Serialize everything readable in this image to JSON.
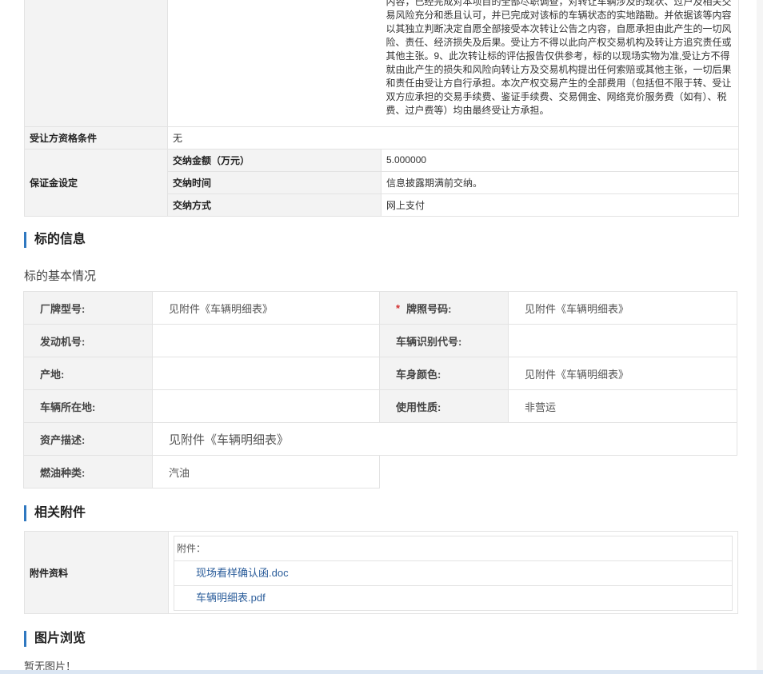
{
  "notes_text": "内容，已经完成对本项目的全部尽职调查，对转让车辆涉及的现状、过户及相关交易风险充分和悉且认可，并已完成对该标的车辆状态的实地踏勘。并依据该等内容以其独立判断决定自愿全部接受本次转让公告之内容，自愿承担由此产生的一切风险、责任、经济损失及后果。受让方不得以此向产权交易机构及转让方追究责任或其他主张。9、此次转让标的评估报告仅供参考，标的以现场实物为准,受让方不得就由此产生的损失和风险向转让方及交易机构提出任何索赔或其他主张，一切后果和责任由受让方自行承担。本次产权交易产生的全部费用（包括但不限于转、受让双方应承担的交易手续费、鉴证手续费、交易佣金、网络竞价服务费（如有）、税费、过户费等）均由最终受让方承担。",
  "qualification": {
    "label": "受让方资格条件",
    "value": "无"
  },
  "deposit": {
    "label": "保证金设定",
    "rows": [
      {
        "label": "交纳金额（万元）",
        "value": "5.000000"
      },
      {
        "label": "交纳时间",
        "value": "信息披露期满前交纳。"
      },
      {
        "label": "交纳方式",
        "value": "网上支付"
      }
    ]
  },
  "section_subject": "标的信息",
  "subject_basic": "标的基本情况",
  "basic": {
    "brand_label": "厂牌型号:",
    "brand_value": "见附件《车辆明细表》",
    "plate_star": "*",
    "plate_label": "牌照号码:",
    "plate_value": "见附件《车辆明细表》",
    "engine_label": "发动机号:",
    "engine_value": "",
    "vin_label": "车辆识别代号:",
    "vin_value": "",
    "origin_label": "产地:",
    "origin_value": "",
    "color_label": "车身颜色:",
    "color_value": "见附件《车辆明细表》",
    "location_label": "车辆所在地:",
    "location_value": "",
    "usage_label": "使用性质:",
    "usage_value": "非营运",
    "asset_label": "资产描述:",
    "asset_value": "见附件《车辆明细表》",
    "fuel_label": "燃油种类:",
    "fuel_value": "汽油"
  },
  "section_attachments": "相关附件",
  "attachments": {
    "label": "附件资料",
    "header": "附件：",
    "files": [
      "现场看样确认函.doc",
      "车辆明细表.pdf"
    ]
  },
  "section_images": "图片浏览",
  "no_images": "暂无图片！",
  "colors": {
    "accent": "#2f78c0",
    "label_bg": "#f3f3f3",
    "border": "#e3e3e3",
    "link": "#2a5c9a"
  }
}
